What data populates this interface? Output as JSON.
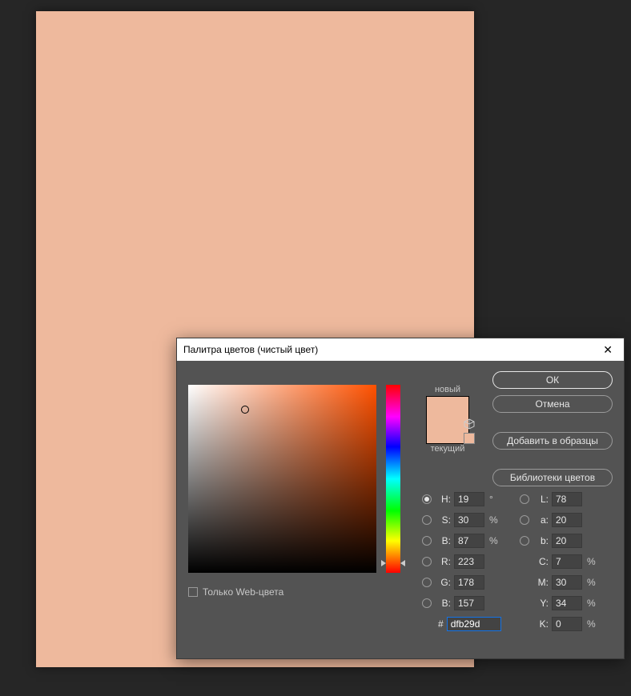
{
  "canvas": {
    "color": "#eeb99d"
  },
  "dialog": {
    "title": "Палитра цветов (чистый цвет)",
    "buttons": {
      "ok": "ОК",
      "cancel": "Отмена",
      "addSwatch": "Добавить в образцы",
      "libraries": "Библиотеки цветов"
    },
    "swatch": {
      "newLabel": "новый",
      "currentLabel": "текущий",
      "newColor": "#eeb99d",
      "currentColor": "#eeb99d"
    },
    "webOnly": {
      "label": "Только Web-цвета",
      "checked": false
    },
    "fields": {
      "H": {
        "label": "H:",
        "value": "19",
        "unit": "°",
        "checked": true
      },
      "S": {
        "label": "S:",
        "value": "30",
        "unit": "%"
      },
      "Bv": {
        "label": "B:",
        "value": "87",
        "unit": "%"
      },
      "R": {
        "label": "R:",
        "value": "223"
      },
      "G": {
        "label": "G:",
        "value": "178"
      },
      "Bb": {
        "label": "B:",
        "value": "157"
      },
      "L": {
        "label": "L:",
        "value": "78"
      },
      "a": {
        "label": "a:",
        "value": "20"
      },
      "b": {
        "label": "b:",
        "value": "20"
      },
      "C": {
        "label": "C:",
        "value": "7",
        "unit": "%"
      },
      "M": {
        "label": "M:",
        "value": "30",
        "unit": "%"
      },
      "Y": {
        "label": "Y:",
        "value": "34",
        "unit": "%"
      },
      "K": {
        "label": "K:",
        "value": "0",
        "unit": "%"
      },
      "hex": {
        "prefix": "#",
        "value": "dfb29d"
      }
    }
  }
}
